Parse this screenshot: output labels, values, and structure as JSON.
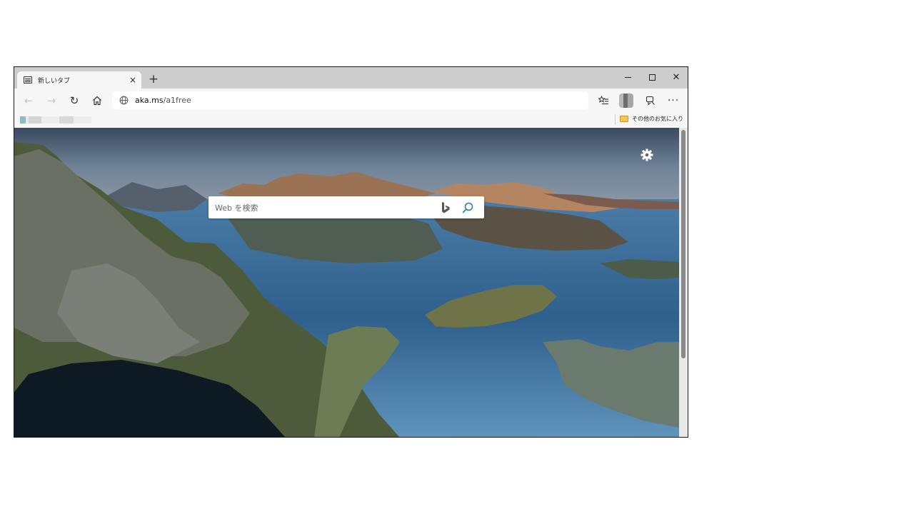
{
  "tab": {
    "title": "新しいタブ",
    "close": "×"
  },
  "new_tab": "+",
  "window_controls": {
    "close": "✕"
  },
  "toolbar": {
    "back": "←",
    "forward": "→",
    "refresh": "↻",
    "home_icon": "home-icon",
    "favorites_icon": "favorites-icon",
    "collections_icon": "collections-icon",
    "more": "···"
  },
  "address": {
    "host": "aka.ms",
    "path": "/a1free"
  },
  "favorites_bar": {
    "other_favorites": "その他のお気に入り"
  },
  "search": {
    "placeholder": "Web を検索"
  },
  "colors": {
    "accent": "#2a7ab0",
    "tab_strip": "#cdcdcd",
    "toolbar": "#f7f7f7",
    "folder": "#f2c75a"
  }
}
